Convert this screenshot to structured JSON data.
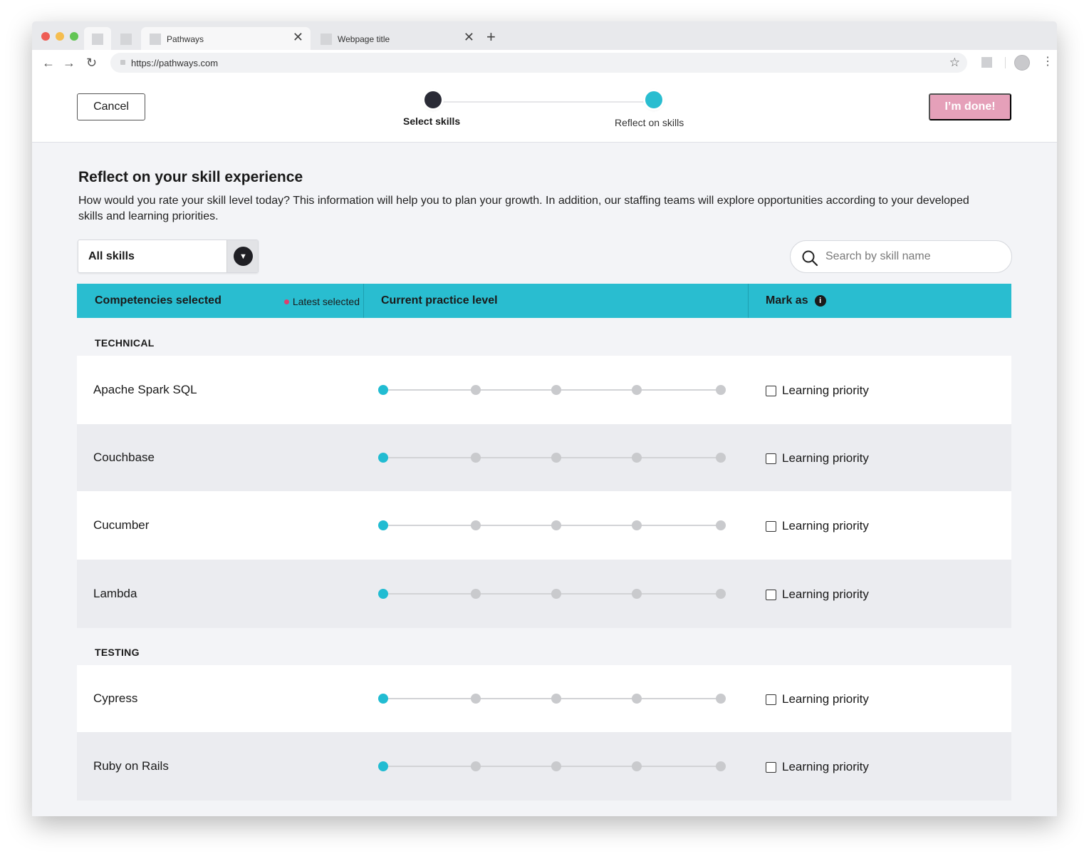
{
  "browser": {
    "tabs": [
      {
        "title": "Pathways",
        "active": true
      },
      {
        "title": "Webpage title",
        "active": false
      }
    ],
    "new_tab_glyph": "+",
    "close_glyph": "✕",
    "url": "https://pathways.com",
    "icons": {
      "back": "←",
      "forward": "→",
      "reload": "↻",
      "star": "☆",
      "menu": "⋮"
    }
  },
  "header": {
    "cancel_label": "Cancel",
    "done_label": "I’m done!",
    "steps": [
      {
        "label": "Select skills",
        "state": "completed"
      },
      {
        "label": "Reflect on skills",
        "state": "current"
      }
    ]
  },
  "content": {
    "title": "Reflect on your skill experience",
    "description": "How would you rate your skill level today? This information will help you to plan your growth. In addition, our staffing teams will explore opportunities according to your developed skills and learning priorities.",
    "filter_value": "All skills",
    "search_placeholder": "Search by skill name"
  },
  "table": {
    "col_competencies": "Competencies selected",
    "latest_selected": "Latest selected",
    "col_practice": "Current practice level",
    "col_mark": "Mark as",
    "info_glyph": "i",
    "checkbox_label": "Learning priority",
    "levels": 5,
    "categories": [
      {
        "name": "TECHNICAL",
        "skills": [
          {
            "name": "Apache Spark SQL",
            "level": 1,
            "priority": false
          },
          {
            "name": "Couchbase",
            "level": 1,
            "priority": false
          },
          {
            "name": "Cucumber",
            "level": 1,
            "priority": false
          },
          {
            "name": "Lambda",
            "level": 1,
            "priority": false
          }
        ]
      },
      {
        "name": "TESTING",
        "skills": [
          {
            "name": "Cypress",
            "level": 1,
            "priority": false
          },
          {
            "name": "Ruby on Rails",
            "level": 1,
            "priority": false
          }
        ]
      }
    ]
  },
  "colors": {
    "accent": "#29bdd0",
    "active_level": "#21bcd2",
    "done_button": "#e5a0b9",
    "latest_dot": "#dd3f6e"
  }
}
